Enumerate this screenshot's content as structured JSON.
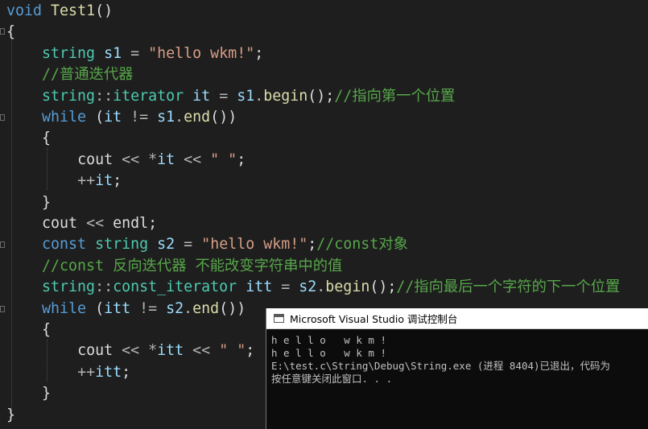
{
  "editor": {
    "lines": [
      [
        {
          "t": "void",
          "c": "kw"
        },
        {
          "t": " ",
          "c": "id"
        },
        {
          "t": "Test1",
          "c": "fn"
        },
        {
          "t": "()",
          "c": "id"
        }
      ],
      [
        {
          "t": "{",
          "c": "id"
        }
      ],
      [
        {
          "t": "    ",
          "c": "id"
        },
        {
          "t": "string",
          "c": "ty"
        },
        {
          "t": " ",
          "c": "id"
        },
        {
          "t": "s1",
          "c": "var"
        },
        {
          "t": " = ",
          "c": "op"
        },
        {
          "t": "\"hello wkm!\"",
          "c": "str"
        },
        {
          "t": ";",
          "c": "id"
        }
      ],
      [
        {
          "t": "    ",
          "c": "id"
        },
        {
          "t": "//普通迭代器",
          "c": "cm"
        }
      ],
      [
        {
          "t": "    ",
          "c": "id"
        },
        {
          "t": "string",
          "c": "ty"
        },
        {
          "t": "::",
          "c": "op"
        },
        {
          "t": "iterator",
          "c": "ty"
        },
        {
          "t": " ",
          "c": "id"
        },
        {
          "t": "it",
          "c": "var"
        },
        {
          "t": " = ",
          "c": "op"
        },
        {
          "t": "s1",
          "c": "var"
        },
        {
          "t": ".",
          "c": "op"
        },
        {
          "t": "begin",
          "c": "fn"
        },
        {
          "t": "();",
          "c": "id"
        },
        {
          "t": "//指向第一个位置",
          "c": "cm"
        }
      ],
      [
        {
          "t": "    ",
          "c": "id"
        },
        {
          "t": "while",
          "c": "kw"
        },
        {
          "t": " (",
          "c": "id"
        },
        {
          "t": "it",
          "c": "var"
        },
        {
          "t": " != ",
          "c": "op"
        },
        {
          "t": "s1",
          "c": "var"
        },
        {
          "t": ".",
          "c": "op"
        },
        {
          "t": "end",
          "c": "fn"
        },
        {
          "t": "())",
          "c": "id"
        }
      ],
      [
        {
          "t": "    {",
          "c": "id"
        }
      ],
      [
        {
          "t": "        ",
          "c": "id"
        },
        {
          "t": "cout",
          "c": "id"
        },
        {
          "t": " << *",
          "c": "op"
        },
        {
          "t": "it",
          "c": "var"
        },
        {
          "t": " << ",
          "c": "op"
        },
        {
          "t": "\" \"",
          "c": "str"
        },
        {
          "t": ";",
          "c": "id"
        }
      ],
      [
        {
          "t": "        ",
          "c": "id"
        },
        {
          "t": "++",
          "c": "op"
        },
        {
          "t": "it",
          "c": "var"
        },
        {
          "t": ";",
          "c": "id"
        }
      ],
      [
        {
          "t": "    }",
          "c": "id"
        }
      ],
      [
        {
          "t": "    ",
          "c": "id"
        },
        {
          "t": "cout",
          "c": "id"
        },
        {
          "t": " << ",
          "c": "op"
        },
        {
          "t": "endl",
          "c": "id"
        },
        {
          "t": ";",
          "c": "id"
        }
      ],
      [
        {
          "t": "    ",
          "c": "id"
        },
        {
          "t": "const",
          "c": "kw"
        },
        {
          "t": " ",
          "c": "id"
        },
        {
          "t": "string",
          "c": "ty"
        },
        {
          "t": " ",
          "c": "id"
        },
        {
          "t": "s2",
          "c": "var"
        },
        {
          "t": " = ",
          "c": "op"
        },
        {
          "t": "\"hello wkm!\"",
          "c": "str"
        },
        {
          "t": ";",
          "c": "id"
        },
        {
          "t": "//const对象",
          "c": "cm"
        }
      ],
      [
        {
          "t": "    ",
          "c": "id"
        },
        {
          "t": "//const 反向迭代器 不能改变字符串中的值",
          "c": "cm"
        }
      ],
      [
        {
          "t": "    ",
          "c": "id"
        },
        {
          "t": "string",
          "c": "ty"
        },
        {
          "t": "::",
          "c": "op"
        },
        {
          "t": "const_iterator",
          "c": "ty"
        },
        {
          "t": " ",
          "c": "id"
        },
        {
          "t": "itt",
          "c": "var"
        },
        {
          "t": " = ",
          "c": "op"
        },
        {
          "t": "s2",
          "c": "var"
        },
        {
          "t": ".",
          "c": "op"
        },
        {
          "t": "begin",
          "c": "fn"
        },
        {
          "t": "();",
          "c": "id"
        },
        {
          "t": "//指向最后一个字符的下一个位置",
          "c": "cm"
        }
      ],
      [
        {
          "t": "    ",
          "c": "id"
        },
        {
          "t": "while",
          "c": "kw"
        },
        {
          "t": " (",
          "c": "id"
        },
        {
          "t": "itt",
          "c": "var"
        },
        {
          "t": " != ",
          "c": "op"
        },
        {
          "t": "s2",
          "c": "var"
        },
        {
          "t": ".",
          "c": "op"
        },
        {
          "t": "end",
          "c": "fn"
        },
        {
          "t": "())",
          "c": "id"
        }
      ],
      [
        {
          "t": "    {",
          "c": "id"
        }
      ],
      [
        {
          "t": "        ",
          "c": "id"
        },
        {
          "t": "cout",
          "c": "id"
        },
        {
          "t": " << *",
          "c": "op"
        },
        {
          "t": "itt",
          "c": "var"
        },
        {
          "t": " << ",
          "c": "op"
        },
        {
          "t": "\" \"",
          "c": "str"
        },
        {
          "t": ";",
          "c": "id"
        }
      ],
      [
        {
          "t": "        ",
          "c": "id"
        },
        {
          "t": "++",
          "c": "op"
        },
        {
          "t": "itt",
          "c": "var"
        },
        {
          "t": ";",
          "c": "id"
        }
      ],
      [
        {
          "t": "    }",
          "c": "id"
        }
      ],
      [
        {
          "t": "}",
          "c": "id"
        }
      ]
    ]
  },
  "console": {
    "title": "Microsoft Visual Studio 调试控制台",
    "lines": [
      "h e l l o   w k m !",
      "h e l l o   w k m !",
      "E:\\test.c\\String\\Debug\\String.exe (进程 8404)已退出，代码为",
      "按任意键关闭此窗口. . ."
    ]
  }
}
